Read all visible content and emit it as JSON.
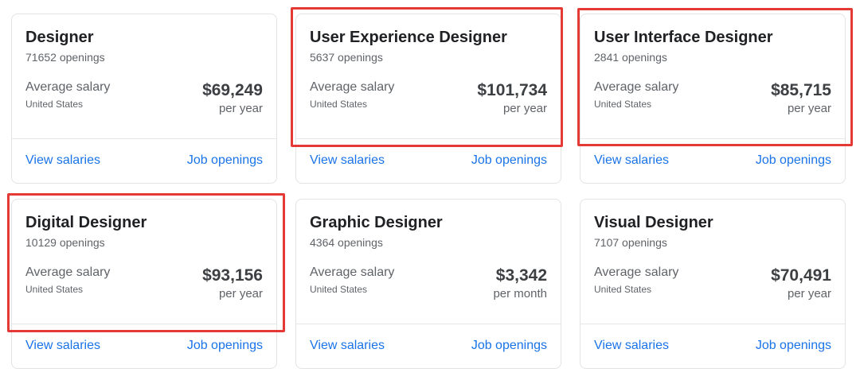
{
  "highlight_color": "#e53935",
  "link_color": "#1a73e8",
  "cards": [
    {
      "title": "Designer",
      "openings": "71652 openings",
      "avg_label": "Average salary",
      "country": "United States",
      "salary": "$69,249",
      "period": "per year",
      "view_salaries": "View salaries",
      "job_openings": "Job openings",
      "highlighted": false
    },
    {
      "title": "User Experience Designer",
      "openings": "5637 openings",
      "avg_label": "Average salary",
      "country": "United States",
      "salary": "$101,734",
      "period": "per year",
      "view_salaries": "View salaries",
      "job_openings": "Job openings",
      "highlighted": true
    },
    {
      "title": "User Interface Designer",
      "openings": "2841 openings",
      "avg_label": "Average salary",
      "country": "United States",
      "salary": "$85,715",
      "period": "per year",
      "view_salaries": "View salaries",
      "job_openings": "Job openings",
      "highlighted": true
    },
    {
      "title": "Digital Designer",
      "openings": "10129 openings",
      "avg_label": "Average salary",
      "country": "United States",
      "salary": "$93,156",
      "period": "per year",
      "view_salaries": "View salaries",
      "job_openings": "Job openings",
      "highlighted": true
    },
    {
      "title": "Graphic Designer",
      "openings": "4364 openings",
      "avg_label": "Average salary",
      "country": "United States",
      "salary": "$3,342",
      "period": "per month",
      "view_salaries": "View salaries",
      "job_openings": "Job openings",
      "highlighted": false
    },
    {
      "title": "Visual Designer",
      "openings": "7107 openings",
      "avg_label": "Average salary",
      "country": "United States",
      "salary": "$70,491",
      "period": "per year",
      "view_salaries": "View salaries",
      "job_openings": "Job openings",
      "highlighted": false
    }
  ]
}
